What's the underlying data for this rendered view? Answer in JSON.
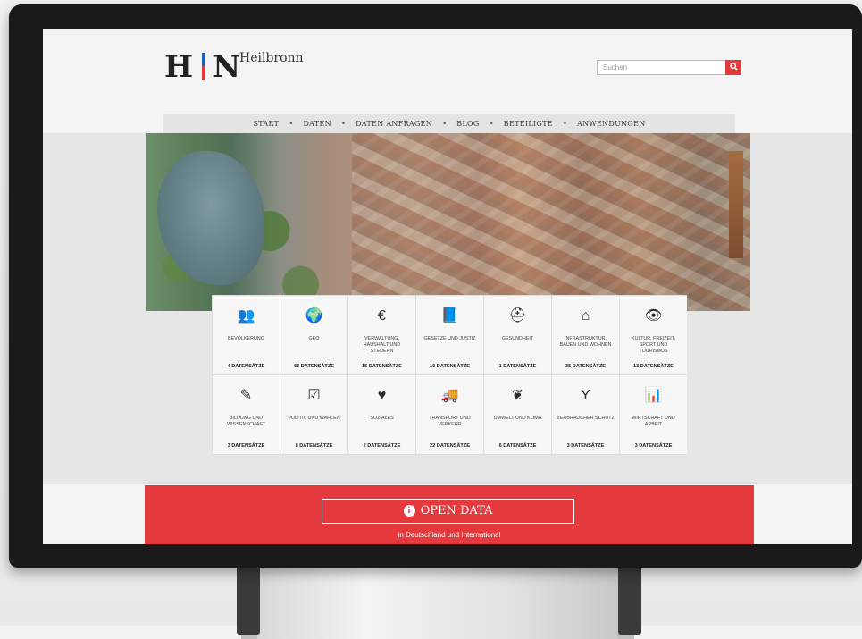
{
  "brand": {
    "logo_left": "H",
    "logo_right": "N",
    "city": "Heilbronn"
  },
  "search": {
    "placeholder": "Suchen",
    "button_icon": "search-icon"
  },
  "nav": {
    "items": [
      "START",
      "DATEN",
      "DATEN ANFRAGEN",
      "BLOG",
      "BETEILIGTE",
      "ANWENDUNGEN"
    ],
    "separator": "•"
  },
  "categories": [
    {
      "icon": "users-icon",
      "glyph": "👥",
      "label": "BEVÖLKERUNG",
      "count": "4 DATENSÄTZE"
    },
    {
      "icon": "globe-icon",
      "glyph": "🌍",
      "label": "GEO",
      "count": "63 DATENSÄTZE"
    },
    {
      "icon": "euro-icon",
      "glyph": "€",
      "label": "VERWALTUNG, HAUSHALT UND STEUERN",
      "count": "15 DATENSÄTZE"
    },
    {
      "icon": "book-icon",
      "glyph": "📘",
      "label": "GESETZE UND JUSTIZ",
      "count": "10 DATENSÄTZE"
    },
    {
      "icon": "medkit-icon",
      "glyph": "⛑",
      "label": "GESUNDHEIT",
      "count": "1 DATENSÄTZE"
    },
    {
      "icon": "home-icon",
      "glyph": "⌂",
      "label": "INFRASTRUKTUR, BAUEN UND WOHNEN",
      "count": "35 DATENSÄTZE"
    },
    {
      "icon": "eye-icon",
      "glyph": "👁",
      "label": "KULTUR, FREIZEIT, SPORT UND TOURISMUS",
      "count": "13 DATENSÄTZE"
    },
    {
      "icon": "pencil-icon",
      "glyph": "✎",
      "label": "BILDUNG UND WISSENSCHAFT",
      "count": "3 DATENSÄTZE"
    },
    {
      "icon": "checkbox-icon",
      "glyph": "☑",
      "label": "POLITIK UND WAHLEN",
      "count": "8 DATENSÄTZE"
    },
    {
      "icon": "heart-icon",
      "glyph": "♥",
      "label": "SOZIALES",
      "count": "2 DATENSÄTZE"
    },
    {
      "icon": "truck-icon",
      "glyph": "🚚",
      "label": "TRANSPORT UND VERKEHR",
      "count": "22 DATENSÄTZE"
    },
    {
      "icon": "leaf-icon",
      "glyph": "❦",
      "label": "UMWELT UND KLIMA",
      "count": "6 DATENSÄTZE"
    },
    {
      "icon": "glass-icon",
      "glyph": "Y",
      "label": "VERBRAUCHER SCHUTZ",
      "count": "3 DATENSÄTZE"
    },
    {
      "icon": "bar-chart-icon",
      "glyph": "📊",
      "label": "WIRTSCHAFT UND ARBEIT",
      "count": "3 DATENSÄTZE"
    }
  ],
  "banner": {
    "button_label": "OPEN DATA",
    "info_icon": "info-icon",
    "info_glyph": "i",
    "subtitle": "in Deutschland und International"
  },
  "colors": {
    "accent": "#e53a3d",
    "logo_blue": "#1f5fb0"
  }
}
